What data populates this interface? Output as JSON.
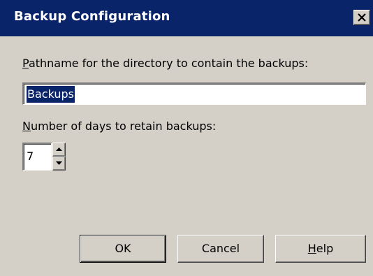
{
  "window": {
    "title": "Backup Configuration"
  },
  "form": {
    "path_label_mnemonic": "P",
    "path_label_rest": "athname for the directory to contain the backups:",
    "path_value": "Backups",
    "days_label_mnemonic": "N",
    "days_label_rest": "umber of days to retain backups:",
    "days_value": "7"
  },
  "buttons": {
    "ok_label": "OK",
    "cancel_label": "Cancel",
    "help_mnemonic": "H",
    "help_rest": "elp"
  },
  "icons": {
    "close": "close-icon",
    "spin_up": "arrow-up-icon",
    "spin_down": "arrow-down-icon"
  },
  "colors": {
    "titlebar": "#0a246a",
    "face": "#d4d0c8",
    "selection": "#0a246a"
  }
}
